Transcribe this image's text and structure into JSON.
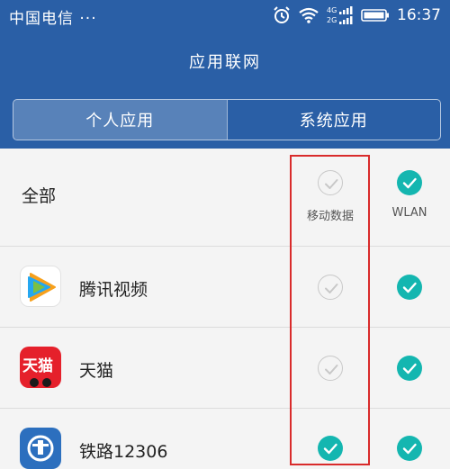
{
  "status_bar": {
    "carrier": "中国电信 ···",
    "time": "16:37",
    "net_4g": "4G",
    "net_2g": "2G"
  },
  "header": {
    "title": "应用联网"
  },
  "tabs": [
    {
      "label": "个人应用",
      "active": true
    },
    {
      "label": "系统应用",
      "active": false
    }
  ],
  "columns": {
    "mobile_data": "移动数据",
    "wlan": "WLAN"
  },
  "all_row": {
    "label": "全部",
    "mobile_data": false,
    "wlan": true
  },
  "apps": [
    {
      "name": "腾讯视频",
      "icon": "tencent-video-icon",
      "mobile_data": false,
      "wlan": true
    },
    {
      "name": "天猫",
      "icon": "tmall-icon",
      "icon_text": "天猫",
      "mobile_data": false,
      "wlan": true
    },
    {
      "name": "铁路12306",
      "icon": "railway-12306-icon",
      "mobile_data": true,
      "wlan": true
    }
  ],
  "colors": {
    "header": "#2a5fa6",
    "check_on": "#14b6b0",
    "highlight": "#d92b2b"
  }
}
